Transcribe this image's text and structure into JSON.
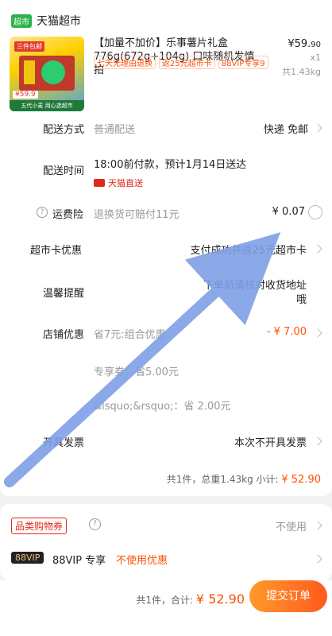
{
  "store": {
    "badge": "超市",
    "name": "天猫超市"
  },
  "product": {
    "title": "【加量不加价】乐事薯片礼盒776g(672g+104g) 口味随机发慎拍",
    "price_main": "¥59.",
    "price_decimal": "90",
    "quantity": "x1",
    "weight": "共1.43kg",
    "tags": [
      "七天无理由退换",
      "返25元超市卡",
      "88VIP专享9"
    ],
    "thumb": {
      "tag": "三件包邮",
      "price": "¥59.9",
      "slogan": "五代小麦 用心选超市"
    }
  },
  "delivery": {
    "label": "配送方式",
    "type": "普通配送",
    "value": "快递 免邮"
  },
  "delivery_time": {
    "label": "配送时间",
    "value": "18:00前付款，预计1月14日送达",
    "badge": "天猫直送"
  },
  "insurance": {
    "icon": "?",
    "label": "运费险",
    "desc": "退换货可赔付11元",
    "value": "¥ 0.07"
  },
  "card_promo": {
    "label": "超市卡优惠",
    "value": "支付成功共返25元超市卡"
  },
  "reminder": {
    "label": "温馨提醒",
    "line1": "下单前请核对收货地址",
    "line2": "哦"
  },
  "shop_discount": {
    "label": "店铺优惠",
    "desc": "省7元:组合优惠",
    "value": "- ¥ 7.00",
    "sub1": "专享券：省5.00元",
    "sub2": "&lsquo;&rsquo;：省 2.00元"
  },
  "invoice": {
    "label": "开具发票",
    "value": "本次不开具发票"
  },
  "summary": {
    "text": "共1件，总重1.43kg 小计:",
    "amount": "¥ 52.90"
  },
  "voucher": {
    "tag": "品类购物券",
    "help": "?",
    "value": "不使用"
  },
  "vip": {
    "badge": "88VIP",
    "label": "88VIP 专享",
    "value": "不使用优惠"
  },
  "bottom": {
    "count": "共1件，合计:",
    "amount": "¥ 52.90",
    "submit": "提交订单"
  }
}
